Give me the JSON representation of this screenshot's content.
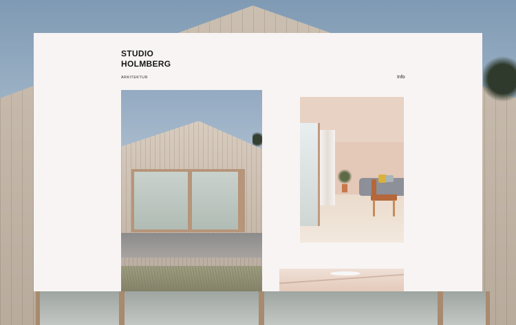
{
  "site": {
    "logo_line1": "STUDIO",
    "logo_line2": "HOLMBERG",
    "subtitle": "ARKITEKTUR"
  },
  "nav": {
    "info_label": "Info"
  },
  "gallery": [
    {
      "name": "house-exterior-photo"
    },
    {
      "name": "interior-living-room-photo"
    },
    {
      "name": "interior-ceiling-photo"
    }
  ],
  "colors": {
    "panel_background": "#f8f4f4",
    "text": "#161616"
  }
}
